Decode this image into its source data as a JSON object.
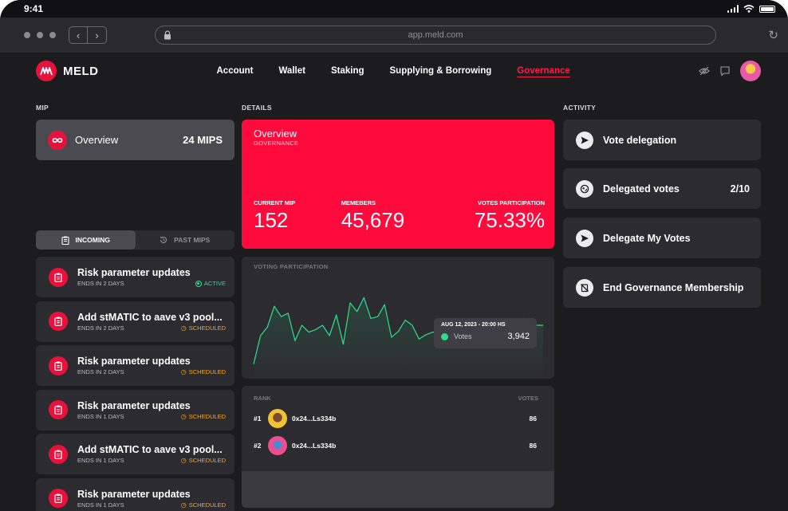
{
  "status_bar": {
    "time": "9:41"
  },
  "browser": {
    "url": "app.meld.com"
  },
  "header": {
    "brand": "MELD",
    "nav": [
      "Account",
      "Wallet",
      "Staking",
      "Supplying & Borrowing",
      "Governance"
    ],
    "active_nav": "Governance"
  },
  "sections": {
    "mip": "MIP",
    "details": "DETAILS",
    "activity": "ACTIVITY"
  },
  "mip": {
    "overview_label": "Overview",
    "overview_count": "24 MIPS",
    "tabs": [
      "INCOMING",
      "PAST MIPS"
    ],
    "active_tab": "INCOMING",
    "items": [
      {
        "title": "Risk parameter updates",
        "ends": "ENDS IN 2 DAYS",
        "status": "ACTIVE"
      },
      {
        "title": "Add stMATIC to aave v3 pool...",
        "ends": "ENDS IN 2 DAYS",
        "status": "SCHEDULED"
      },
      {
        "title": "Risk parameter updates",
        "ends": "ENDS IN 2 DAYS",
        "status": "SCHEDULED"
      },
      {
        "title": "Risk parameter updates",
        "ends": "ENDS IN 1 DAYS",
        "status": "SCHEDULED"
      },
      {
        "title": "Add stMATIC to aave v3 pool...",
        "ends": "ENDS IN 1 DAYS",
        "status": "SCHEDULED"
      },
      {
        "title": "Risk parameter updates",
        "ends": "ENDS IN 1 DAYS",
        "status": "SCHEDULED"
      }
    ]
  },
  "details": {
    "title": "Overview",
    "subtitle": "GOVERNANCE",
    "stats": [
      {
        "label": "CURRENT MIP",
        "value": "152"
      },
      {
        "label": "MEMEBERS",
        "value": "45,679"
      },
      {
        "label": "VOTES PARTICIPATION",
        "value": "75.33%"
      }
    ]
  },
  "voting_participation": {
    "label": "VOTING PARTICIPATION",
    "tooltip": {
      "date": "AUG 12, 2023 - 20:00 HS",
      "series": "Votes",
      "value": "3,942"
    },
    "points": [
      0.05,
      0.38,
      0.48,
      0.72,
      0.6,
      0.64,
      0.32,
      0.5,
      0.42,
      0.45,
      0.5,
      0.38,
      0.62,
      0.28,
      0.76,
      0.66,
      0.82,
      0.58,
      0.6,
      0.74,
      0.36,
      0.43,
      0.56,
      0.5,
      0.34,
      0.39,
      0.42,
      0.42,
      0.4,
      0.52,
      0.47,
      0.46,
      0.45,
      0.5,
      0.45,
      0.5,
      0.5,
      0.52,
      0.42,
      0.46,
      0.58,
      0.5,
      0.5
    ]
  },
  "rank": {
    "headers": {
      "rank": "RANK",
      "votes": "VOTES"
    },
    "rows": [
      {
        "rank": "#1",
        "address": "0x24...Ls334b",
        "votes": "86"
      },
      {
        "rank": "#2",
        "address": "0x24...Ls334b",
        "votes": "86"
      }
    ]
  },
  "activity": [
    {
      "label": "Vote delegation",
      "icon": "send-icon",
      "count": ""
    },
    {
      "label": "Delegated votes",
      "icon": "delegate-icon",
      "count": "2/10"
    },
    {
      "label": "Delegate My Votes",
      "icon": "send-icon",
      "count": ""
    },
    {
      "label": "End Governance Membership",
      "icon": "end-membership-icon",
      "count": ""
    }
  ],
  "colors": {
    "brand": "#ff0a3c",
    "active": "#2be08c",
    "scheduled": "#f5a623",
    "chart_line": "#2be08c"
  }
}
